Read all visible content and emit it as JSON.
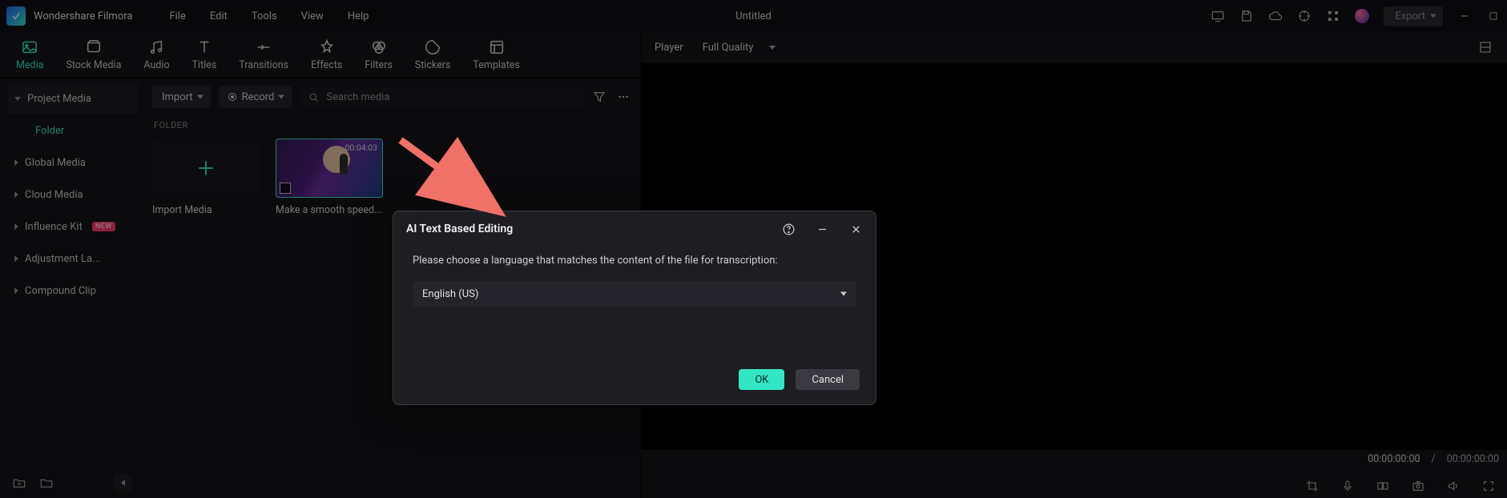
{
  "app_name": "Wondershare Filmora",
  "menus": {
    "file": "File",
    "edit": "Edit",
    "tools": "Tools",
    "view": "View",
    "help": "Help"
  },
  "document_title": "Untitled",
  "export_label": "Export",
  "tabs": {
    "media": "Media",
    "stock_media": "Stock Media",
    "audio": "Audio",
    "titles": "Titles",
    "transitions": "Transitions",
    "effects": "Effects",
    "filters": "Filters",
    "stickers": "Stickers",
    "templates": "Templates"
  },
  "sidebar": {
    "project_media": "Project Media",
    "folder": "Folder",
    "global_media": "Global Media",
    "cloud_media": "Cloud Media",
    "influence_kit": "Influence Kit",
    "influence_badge": "NEW",
    "adjustment": "Adjustment La...",
    "compound_clip": "Compound Clip"
  },
  "toolbar": {
    "import": "Import",
    "record": "Record",
    "search_placeholder": "Search media"
  },
  "section_label": "FOLDER",
  "cards": {
    "import_media": "Import Media",
    "clip_label": "Make a smooth speed...",
    "clip_duration": "00:04:03"
  },
  "player": {
    "label": "Player",
    "quality": "Full Quality",
    "time_current": "00:00:00:00",
    "time_sep": "/",
    "time_total": "00:00:00:00"
  },
  "dialog": {
    "title": "AI Text Based Editing",
    "message": "Please choose a language that matches the content of the file for transcription:",
    "language": "English (US)",
    "ok": "OK",
    "cancel": "Cancel"
  }
}
